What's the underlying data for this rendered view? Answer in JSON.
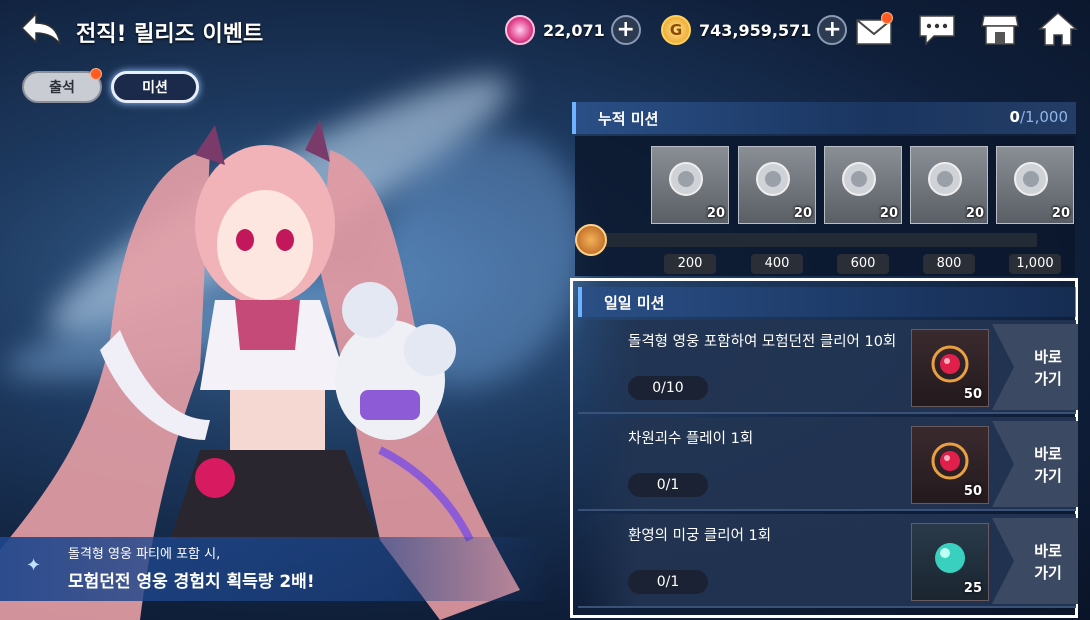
{
  "header": {
    "title": "전직! 릴리즈 이벤트",
    "currency1": {
      "icon": "gem-icon",
      "value": "22,071"
    },
    "currency2": {
      "icon": "gold-coin-icon",
      "symbol": "G",
      "value": "743,959,571"
    },
    "plus": "+"
  },
  "tabs": [
    {
      "label": "출석",
      "notify": true
    },
    {
      "label": "미션",
      "selected": true
    }
  ],
  "promo": {
    "line1": "돌격형 영웅 파티에 포함 시,",
    "line2": "모험던전 영웅 경험치 획득량 2배!"
  },
  "cumulative": {
    "title": "누적 미션",
    "progress": "0",
    "total": "1,000",
    "progress_fraction": 0,
    "rewards": [
      {
        "count": "20"
      },
      {
        "count": "20"
      },
      {
        "count": "20"
      },
      {
        "count": "20"
      },
      {
        "count": "20"
      }
    ],
    "milestones": [
      "200",
      "400",
      "600",
      "800",
      "1,000"
    ]
  },
  "daily": {
    "title": "일일 미션",
    "go_label": "바로 가기",
    "missions": [
      {
        "text": "돌격형 영웅 포함하여 모험던전 클리어 10회",
        "progress": "0/10",
        "reward_count": "50",
        "reward_icon": "red-gem-icon"
      },
      {
        "text": "차원괴수 플레이 1회",
        "progress": "0/1",
        "reward_count": "50",
        "reward_icon": "red-gem-icon"
      },
      {
        "text": "환영의 미궁 클리어 1회",
        "progress": "0/1",
        "reward_count": "25",
        "reward_icon": "blue-orb-icon"
      }
    ]
  },
  "colors": {
    "accent": "#6fb2ff",
    "notify": "#ff5a1f",
    "gold": "#e8a83a"
  }
}
